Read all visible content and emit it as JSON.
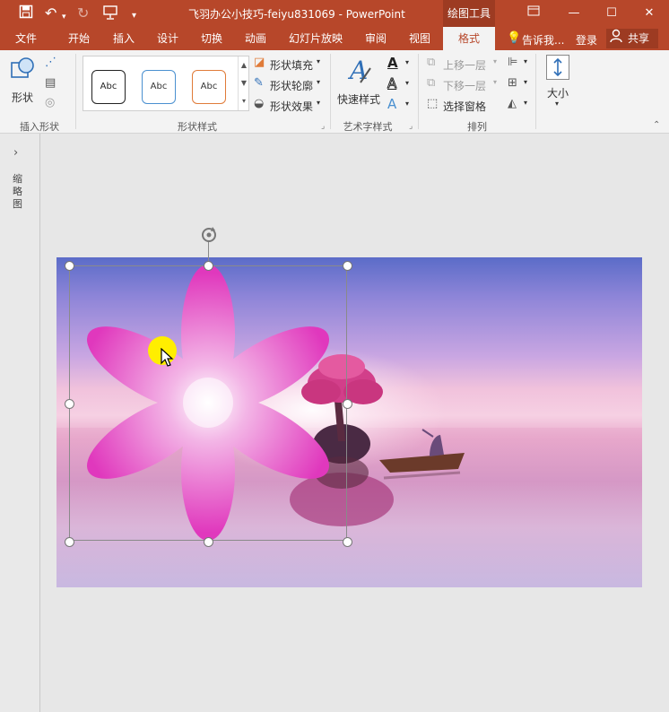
{
  "titlebar": {
    "title": "飞羽办公小技巧-feiyu831069 - PowerPoint",
    "context_tool": "绘图工具"
  },
  "tabs": [
    "文件",
    "开始",
    "插入",
    "设计",
    "切换",
    "动画",
    "幻灯片放映",
    "审阅",
    "视图",
    "格式"
  ],
  "tellme": "告诉我...",
  "login": "登录",
  "share": "共享",
  "ribbon": {
    "shape_label": "形状",
    "insert_shapes_group": "插入形状",
    "style_samples": [
      "Abc",
      "Abc",
      "Abc"
    ],
    "fill": "形状填充",
    "outline": "形状轮廓",
    "effects": "形状效果",
    "shape_styles_group": "形状样式",
    "quick_styles": "快速样式",
    "wordart_group": "艺术字样式",
    "bring_forward": "上移一层",
    "send_backward": "下移一层",
    "selection_pane": "选择窗格",
    "arrange_group": "排列",
    "size_label": "大小"
  },
  "left_pane": {
    "label": "缩略图"
  },
  "colors": {
    "accent": "#b7472a",
    "accent_dark": "#9d3b22",
    "petal": "#e040c0",
    "cursor_highlight": "#ffee00"
  },
  "icons": [
    "save-icon",
    "undo-icon",
    "redo-icon",
    "present-icon",
    "customize-icon",
    "ribbon-options-icon",
    "minimize-icon",
    "maximize-icon",
    "close-icon",
    "lightbulb-icon",
    "person-icon",
    "rotate-handle-icon",
    "chevron-right-icon",
    "pointer-cursor-icon"
  ]
}
